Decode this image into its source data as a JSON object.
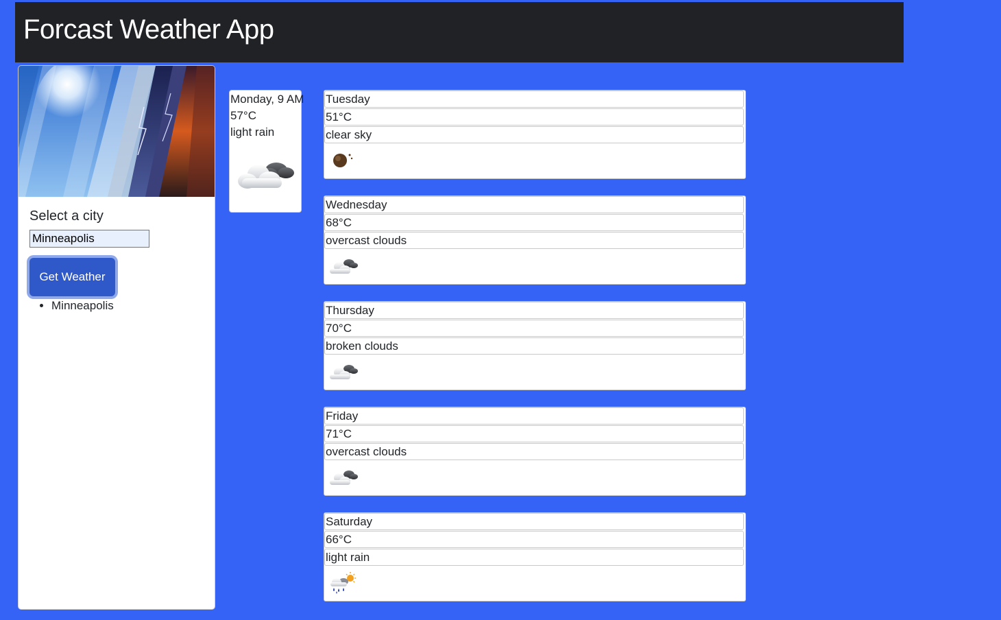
{
  "app": {
    "title": "Forcast Weather App"
  },
  "sidebar": {
    "label": "Select a city",
    "input_value": "Minneapolis",
    "button_label": "Get Weather",
    "history": [
      "Minneapolis"
    ]
  },
  "current": {
    "datetime": "Monday, 9 AM",
    "temp": "57°C",
    "condition": "light rain",
    "icon": "cloud-icon"
  },
  "forecast": [
    {
      "day": "Tuesday",
      "temp": "51°C",
      "condition": "clear sky",
      "icon": "clear-night-icon"
    },
    {
      "day": "Wednesday",
      "temp": "68°C",
      "condition": "overcast clouds",
      "icon": "cloud-icon"
    },
    {
      "day": "Thursday",
      "temp": "70°C",
      "condition": "broken clouds",
      "icon": "cloud-icon"
    },
    {
      "day": "Friday",
      "temp": "71°C",
      "condition": "overcast clouds",
      "icon": "cloud-icon"
    },
    {
      "day": "Saturday",
      "temp": "66°C",
      "condition": "light rain",
      "icon": "rain-sun-icon"
    }
  ],
  "colors": {
    "page_bg": "#3563f5",
    "navbar_bg": "#212226",
    "button_bg": "#2f58c9"
  }
}
